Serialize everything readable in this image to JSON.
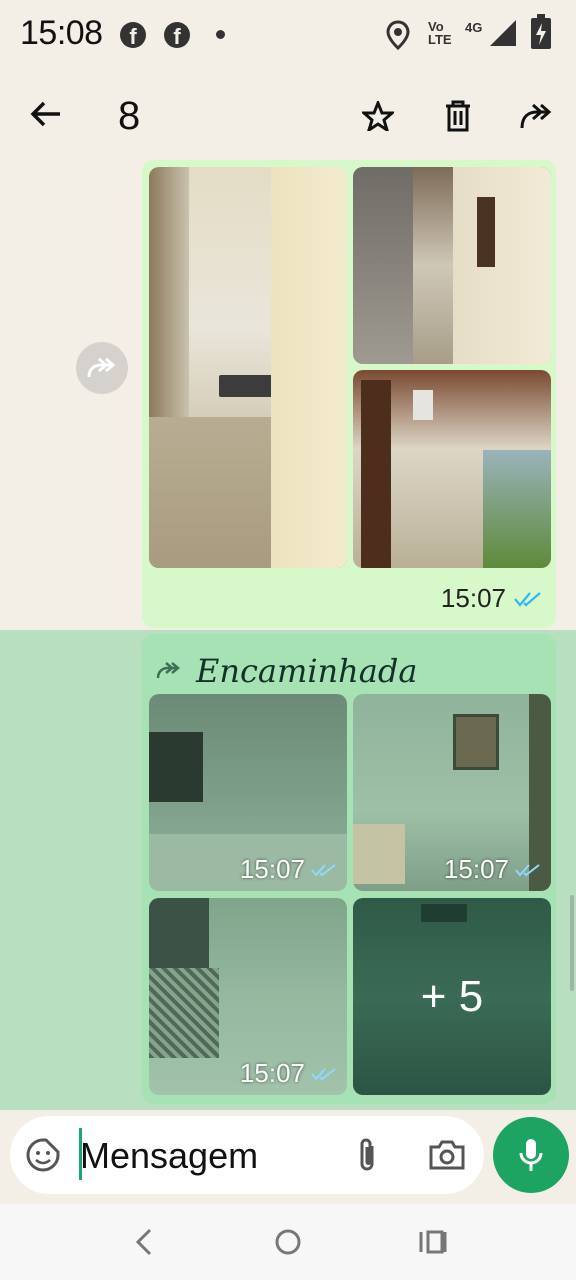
{
  "status_bar": {
    "time": "15:08",
    "icons": [
      "facebook-icon",
      "facebook-icon",
      "dot-icon",
      "location-icon",
      "volte-icon",
      "4g-icon",
      "signal-icon",
      "battery-icon"
    ],
    "volte_label_1": "Vo",
    "volte_label_2": "LTE",
    "network_label": "4G"
  },
  "top_bar": {
    "selected_count": "8",
    "icons": [
      "back-arrow-icon",
      "star-icon",
      "trash-icon",
      "forward-icon"
    ]
  },
  "messages": [
    {
      "type": "photo-group",
      "time": "15:07",
      "status": "read",
      "photos": [
        "photo-corridor-sink",
        "photo-balcony-1",
        "photo-balcony-2"
      ]
    },
    {
      "type": "forwarded-photo-group",
      "forwarded_label": "Encaminhada",
      "photos": [
        {
          "name": "photo-room",
          "time": "15:07"
        },
        {
          "name": "photo-bathroom",
          "time": "15:07"
        },
        {
          "name": "photo-tiled-room",
          "time": "15:07"
        },
        {
          "name": "photo-more",
          "more_label": "+ 5"
        }
      ]
    }
  ],
  "input_bar": {
    "placeholder": "Mensagem",
    "icons": [
      "sticker-icon",
      "attach-icon",
      "camera-icon",
      "mic-icon"
    ]
  },
  "nav_bar": {
    "icons": [
      "nav-back-icon",
      "nav-home-icon",
      "nav-recents-icon"
    ]
  },
  "colors": {
    "background": "#f3efe7",
    "bubble": "#d7f8c9",
    "selection": "#b7dfc0",
    "accent": "#1da463",
    "read_tick": "#4fc3f7"
  }
}
